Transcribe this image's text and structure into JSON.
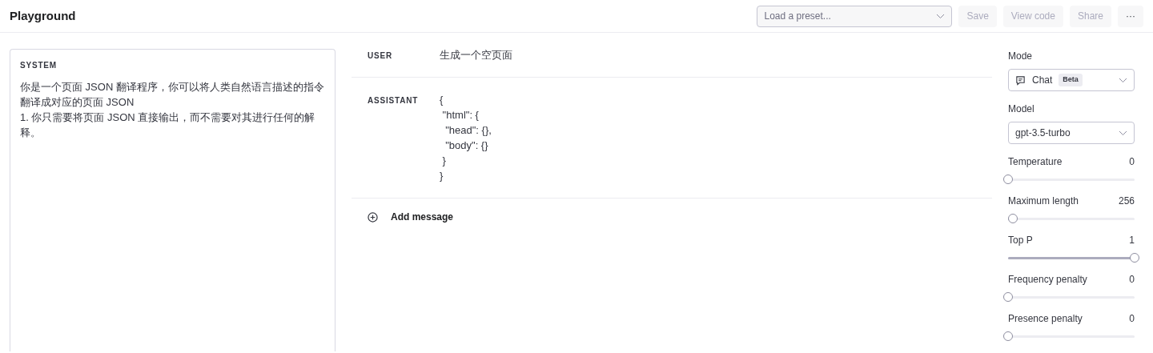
{
  "header": {
    "title": "Playground",
    "preset": {
      "placeholder": "Load a preset..."
    },
    "buttons": [
      {
        "label": "Save",
        "disabled": true
      },
      {
        "label": "View code",
        "disabled": true
      },
      {
        "label": "Share",
        "disabled": true
      },
      {
        "label": "···",
        "disabled": false
      }
    ]
  },
  "system": {
    "label": "SYSTEM",
    "text": "你是一个页面 JSON 翻译程序，你可以将人类自然语言描述的指令翻译成对应的页面 JSON\n1. 你只需要将页面 JSON 直接输出，而不需要对其进行任何的解释。"
  },
  "messages": [
    {
      "role": "USER",
      "text": "生成一个空页面"
    },
    {
      "role": "ASSISTANT",
      "text": "{\n \"html\": {\n  \"head\": {},\n  \"body\": {}\n }\n}"
    }
  ],
  "add_message": "Add message",
  "settings": {
    "mode": {
      "label": "Mode",
      "value": "Chat",
      "badge": "Beta"
    },
    "model": {
      "label": "Model",
      "value": "gpt-3.5-turbo"
    },
    "sliders": [
      {
        "label": "Temperature",
        "reading": "0",
        "level": 0
      },
      {
        "label": "Maximum length",
        "reading": "256",
        "level": 0.04
      },
      {
        "label": "Top P",
        "reading": "1",
        "level": 1
      },
      {
        "label": "Frequency penalty",
        "reading": "0",
        "level": 0
      },
      {
        "label": "Presence penalty",
        "reading": "0",
        "level": 0
      }
    ]
  }
}
